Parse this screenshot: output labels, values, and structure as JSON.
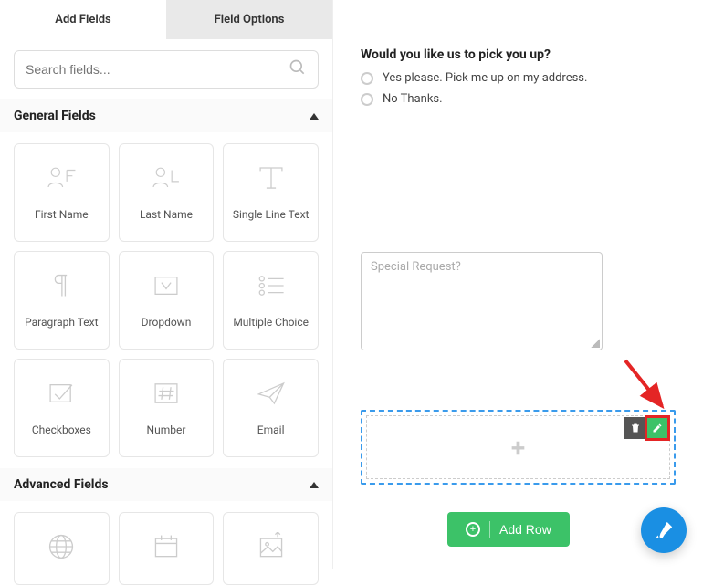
{
  "tabs": {
    "add_fields": "Add Fields",
    "field_options": "Field Options"
  },
  "search": {
    "placeholder": "Search fields..."
  },
  "sections": {
    "general": {
      "title": "General Fields",
      "fields": [
        {
          "label": "First Name"
        },
        {
          "label": "Last Name"
        },
        {
          "label": "Single Line Text"
        },
        {
          "label": "Paragraph Text"
        },
        {
          "label": "Dropdown"
        },
        {
          "label": "Multiple Choice"
        },
        {
          "label": "Checkboxes"
        },
        {
          "label": "Number"
        },
        {
          "label": "Email"
        }
      ]
    },
    "advanced": {
      "title": "Advanced Fields"
    }
  },
  "preview": {
    "question": "Would you like us to pick you up?",
    "options": [
      "Yes please. Pick me up on my address.",
      "No Thanks."
    ],
    "textarea_placeholder": "Special Request?",
    "add_row": "Add Row"
  }
}
